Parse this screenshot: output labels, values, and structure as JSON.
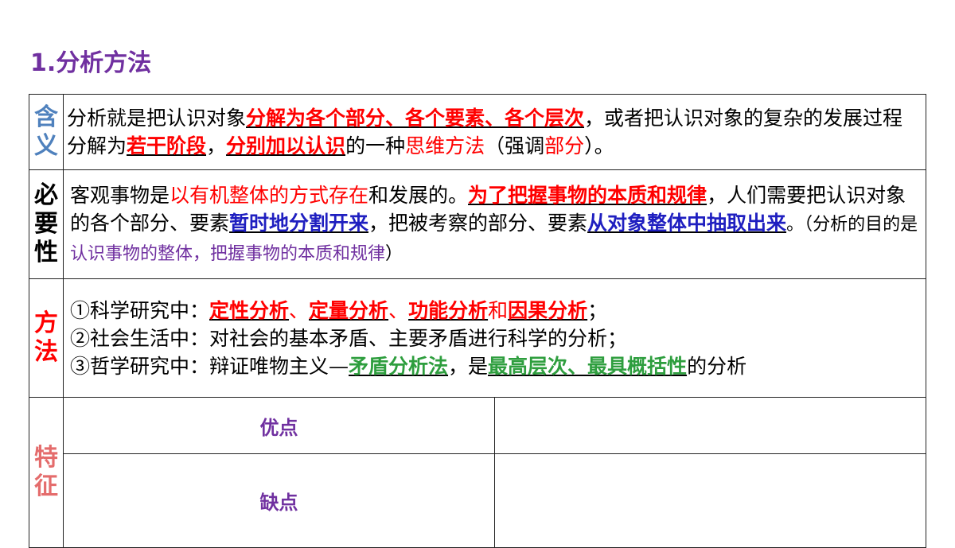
{
  "title": "1.分析方法",
  "rows": {
    "meaning": {
      "label_chars": [
        "含",
        "义"
      ],
      "parts": [
        "分析就是把认识对象",
        "分解为各个部分、各个要素、各个层次",
        "，或者把认识对象的复杂的发展过程分解为",
        "若干阶段",
        "，",
        "分别加以认识",
        "的一种",
        "思维方法",
        "（强调",
        "部分",
        "）。"
      ]
    },
    "necessity": {
      "label_chars": [
        "必",
        "要",
        "性"
      ],
      "parts": [
        "客观事物是",
        "以有机整体的方式存在",
        "和发展的。",
        "为了把握事物的本质和规律",
        "，人们需要把认识对象的各个部分、要素",
        "暂时地分割开来",
        "，把被考察的部分、要素",
        "从对象整体中抽取出来",
        "。（分析的目的是",
        "认识事物的整体，把握事物的本质和规律",
        "）"
      ]
    },
    "method": {
      "label_chars": [
        "方",
        "法"
      ],
      "line1": [
        "①科学研究中：",
        "定性分析",
        "、",
        "定量分析",
        "、",
        "功能分析",
        "和",
        "因果分析",
        "；"
      ],
      "line2": "②社会生活中：对社会的基本矛盾、主要矛盾进行科学的分析；",
      "line3": [
        "③哲学研究中：辩证唯物主义—",
        "矛盾分析法",
        "，是",
        "最高层次、最具概括性",
        "的分析"
      ]
    },
    "features": {
      "label_chars": [
        "特",
        "征"
      ],
      "advantages_label": "优点",
      "advantages_value": "",
      "disadvantages_label": "缺点",
      "disadvantages_value": ""
    }
  },
  "colors": {
    "title": "#7030A0",
    "emphasis_red": "#FF0000",
    "emphasis_blue": "#1F1FC0",
    "emphasis_green": "#2E9E3E",
    "label_meaning": "#4F81BD",
    "label_method": "#FF0000",
    "label_features": "#E46C6C"
  }
}
